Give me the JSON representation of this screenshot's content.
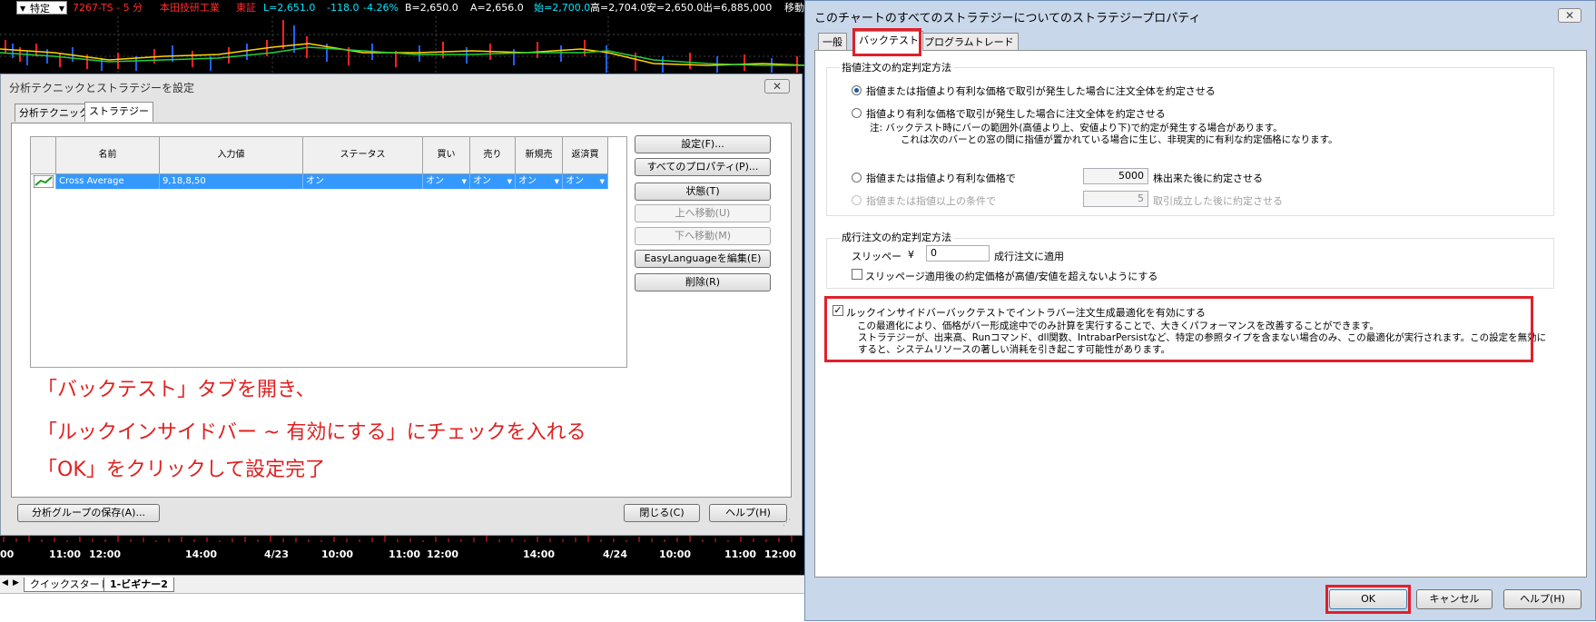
{
  "chart": {
    "header": {
      "dropdown_label": "特定",
      "symbol": "7267-TS - 5 分",
      "company": "本田技研工業",
      "exchange": "東証",
      "last": "L=2,651.0",
      "change": "-118.0",
      "change_pct": "-4.26%",
      "bid": "B=2,650.0",
      "ask": "A=2,656.0",
      "open_label": "始=2,700.0",
      "high": "高=2,704.0",
      "low": "安=2,650.0",
      "volume": "出=6,885,000",
      "trailing": "移動"
    },
    "time_axis": [
      "00",
      "11:00",
      "12:00",
      "14:00",
      "4/23",
      "10:00",
      "11:00",
      "12:00",
      "14:00",
      "4/24",
      "10:00",
      "11:00",
      "12:00"
    ],
    "workspace_tabs": [
      "クイックスタート",
      "1-ビギナー2"
    ]
  },
  "left_dialog": {
    "title": "分析テクニックとストラテジーを設定",
    "close": "✕",
    "tabs": [
      "分析テクニック",
      "ストラテジー"
    ],
    "columns": [
      "名前",
      "入力値",
      "ステータス",
      "買い",
      "売り",
      "新規売",
      "返済買"
    ],
    "row": {
      "name": "Cross Average",
      "inputs": "9,18,8,50",
      "status": "オン",
      "buy": "オン",
      "sell": "オン",
      "short": "オン",
      "cover": "オン"
    },
    "buttons": {
      "settings": "設定(F)...",
      "all_properties": "すべてのプロパティ(P)...",
      "state": "状態(T)",
      "move_up": "上へ移動(U)",
      "move_down": "下へ移動(M)",
      "edit_el": "EasyLanguageを編集(E)",
      "delete": "削除(R)"
    },
    "notes": [
      "「バックテスト」タブを開き、",
      "「ルックインサイドバー ~ 有効にする」にチェックを入れる",
      "「OK」をクリックして設定完了"
    ],
    "save_group": "分析グループの保存(A)...",
    "close_button": "閉じる(C)",
    "help_button": "ヘルプ(H)"
  },
  "right_dialog": {
    "title": "このチャートのすべてのストラテジーについてのストラテジープロパティ",
    "close": "✕",
    "tabs": [
      "一般",
      "バックテスト",
      "プログラムトレード"
    ],
    "limit_section": {
      "title": "指値注文の約定判定方法",
      "opt1": "指値または指値より有利な価格で取引が発生した場合に注文全体を約定させる",
      "opt2": "指値より有利な価格で取引が発生した場合に注文全体を約定させる",
      "opt2_note1": "注: バックテスト時にバーの範囲外(高値より上、安値より下)で約定が発生する場合があります。",
      "opt2_note2": "これは次のバーとの窓の間に指値が置かれている場合に生じ、非現実的に有利な約定価格になります。",
      "opt3": "指値または指値より有利な価格で",
      "opt3_value": "5000",
      "opt3_suffix": "株出来た後に約定させる",
      "opt4": "指値または指値以上の条件で",
      "opt4_value": "5",
      "opt4_suffix": "取引成立した後に約定させる"
    },
    "market_section": {
      "title": "成行注文の約定判定方法",
      "slippage_label": "スリッペー",
      "yen": "¥",
      "slippage_value": "0",
      "apply_label": "成行注文に適用",
      "limit_check": "スリッページ適用後の約定価格が高値/安値を超えないようにする"
    },
    "lookinside": {
      "label": "ルックインサイドバーバックテストでイントラバー注文生成最適化を有効にする",
      "desc1": "この最適化により、価格がバー形成途中でのみ計算を実行することで、大きくパフォーマンスを改善することができます。",
      "desc2": "ストラテジーが、出来高、Runコマンド、dll関数、IntrabarPersistなど、特定の参照タイプを含まない場合のみ、この最適化が実行されます。この設定を無効に",
      "desc3": "すると、システムリソースの著しい消耗を引き起こす可能性があります。"
    },
    "ok": "OK",
    "cancel": "キャンセル",
    "help": "ヘルプ(H)"
  },
  "colors": {
    "highlight_red": "#e0202a",
    "selection_blue": "#3399ff",
    "header_cyan": "#00e5ff",
    "header_red": "#ff2d2d"
  }
}
